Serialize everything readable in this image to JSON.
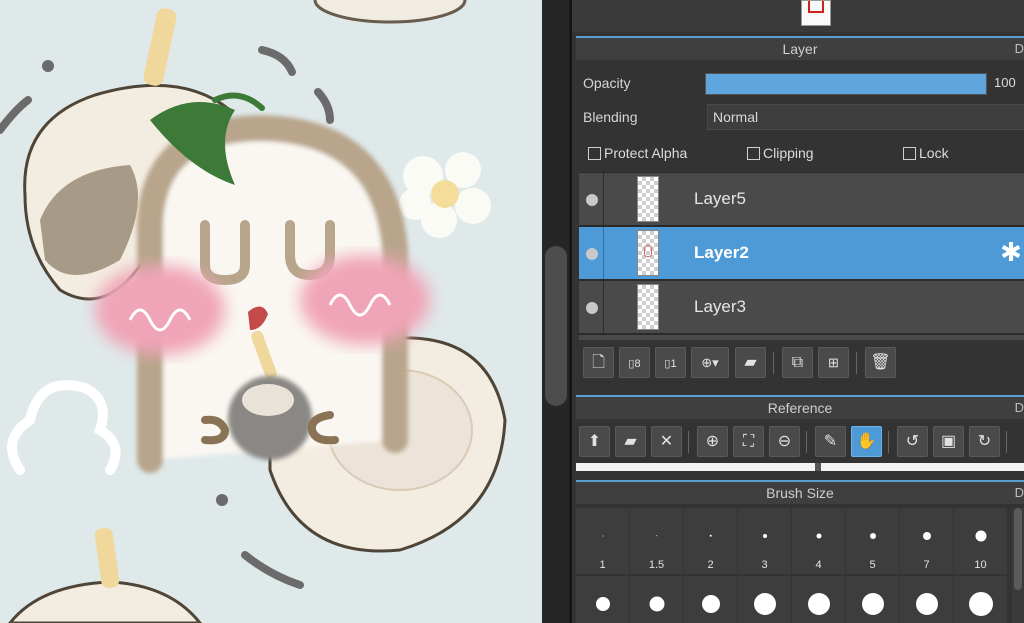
{
  "layer_panel": {
    "title": "Layer",
    "corner_label": "D",
    "opacity_label": "Opacity",
    "opacity_value": "100",
    "opacity_fraction": 1.0,
    "blending_label": "Blending",
    "blending_value": "Normal",
    "protect_alpha_label": "Protect Alpha",
    "clipping_label": "Clipping",
    "lock_label": "Lock",
    "layers": [
      {
        "name": "Layer5",
        "selected": false
      },
      {
        "name": "Layer2",
        "selected": true
      },
      {
        "name": "Layer3",
        "selected": false
      }
    ]
  },
  "reference_panel": {
    "title": "Reference",
    "corner_label": "D"
  },
  "brush_size_panel": {
    "title": "Brush Size",
    "corner_label": "D",
    "sizes": [
      "1",
      "1.5",
      "2",
      "3",
      "4",
      "5",
      "7",
      "10"
    ]
  },
  "colors": {
    "accent": "#4e9ad6",
    "panel_bg": "#333333",
    "canvas_bg": "#dfe9ea"
  },
  "icons": {
    "layer_toolbar": [
      "new-layer-icon",
      "new-layer-8bit-icon",
      "new-layer-1bit-icon",
      "add-layer-dropdown-icon",
      "folder-icon",
      "duplicate-icon",
      "merge-icon",
      "delete-icon"
    ],
    "reference_toolbar": [
      "upload-icon",
      "open-folder-icon",
      "close-icon",
      "zoom-in-icon",
      "fit-icon",
      "zoom-out-icon",
      "eyedropper-icon",
      "hand-icon",
      "rotate-left-icon",
      "reset-icon",
      "rotate-right-icon"
    ]
  }
}
